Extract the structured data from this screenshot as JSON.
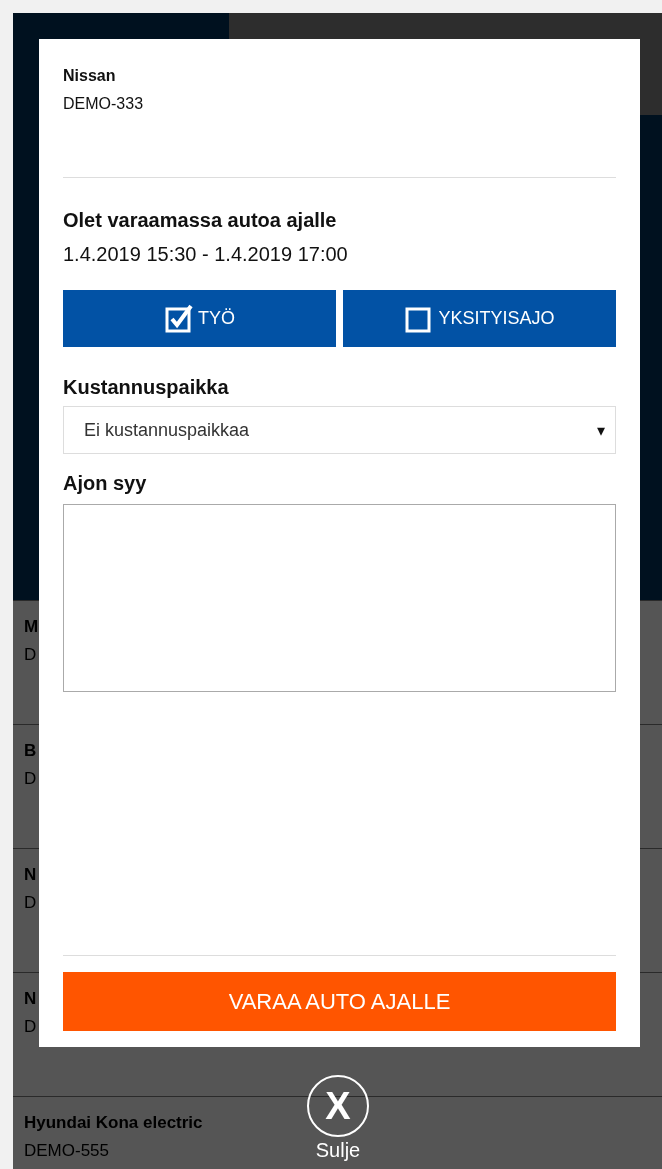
{
  "nav_tabs": [
    {
      "selected": true
    },
    {
      "selected": false
    },
    {
      "selected": false
    }
  ],
  "list_rows": [
    {
      "name": "M",
      "plate": "D"
    },
    {
      "name": "B",
      "plate": "D"
    },
    {
      "name": "N",
      "plate": "D"
    },
    {
      "name": "N",
      "plate": "D"
    },
    {
      "name": "Hyundai Kona electric",
      "plate": "DEMO-555"
    }
  ],
  "dialog": {
    "car_name": "Nissan",
    "plate": "DEMO-333",
    "heading": "Olet varaamassa autoa ajalle",
    "period": "1.4.2019 15:30 - 1.4.2019 17:00",
    "trip_types": [
      {
        "label": "TYÖ",
        "checked": true
      },
      {
        "label": "YKSITYISAJO",
        "checked": false
      }
    ],
    "cost_center": {
      "label": "Kustannuspaikka",
      "value": "Ei kustannuspaikkaa",
      "caret": "▾"
    },
    "reason": {
      "label": "Ajon syy"
    },
    "submit": "VARAA AUTO AJALLE"
  },
  "close": {
    "icon": "X",
    "label": "Sulje"
  }
}
